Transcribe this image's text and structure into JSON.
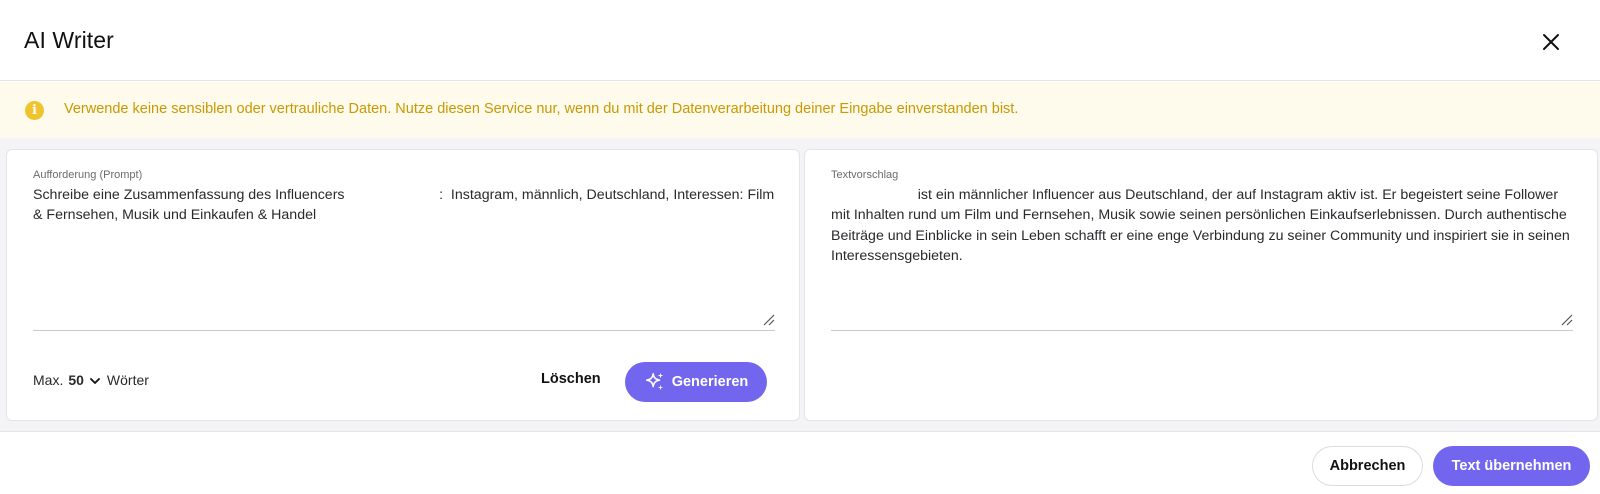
{
  "header": {
    "title": "AI Writer",
    "close_icon": "close-icon"
  },
  "notice": {
    "icon": "info-icon",
    "icon_glyph": "i",
    "text": "Verwende keine sensiblen oder vertrauliche Daten. Nutze diesen Service nur, wenn du mit der Datenverarbeitung deiner Eingabe einverstanden bist.",
    "color": "#c79a04",
    "background": "#fefaec"
  },
  "prompt_panel": {
    "label": "Aufforderung (Prompt)",
    "value": "Schreibe eine Zusammenfassung des Influencers                        :  Instagram, männlich, Deutschland, Interessen: Film & Fernsehen, Musik und Einkaufen & Handel",
    "max_prefix": "Max.",
    "max_value": "50",
    "max_suffix": "Wörter",
    "delete_label": "Löschen",
    "generate_label": "Generieren",
    "generate_icon": "sparkles-icon"
  },
  "suggestion_panel": {
    "label": "Textvorschlag",
    "value": "                      ist ein männlicher Influencer aus Deutschland, der auf Instagram aktiv ist. Er begeistert seine Follower mit Inhalten rund um Film und Fernsehen, Musik sowie seinen persönlichen Einkaufserlebnissen. Durch authentische Beiträge und Einblicke in sein Leben schafft er eine enge Verbindung zu seiner Community und inspiriert sie in seinen Interessensgebieten."
  },
  "footer": {
    "cancel_label": "Abbrechen",
    "apply_label": "Text übernehmen"
  },
  "colors": {
    "accent": "#7266ee",
    "warning_icon": "#efc42f"
  }
}
